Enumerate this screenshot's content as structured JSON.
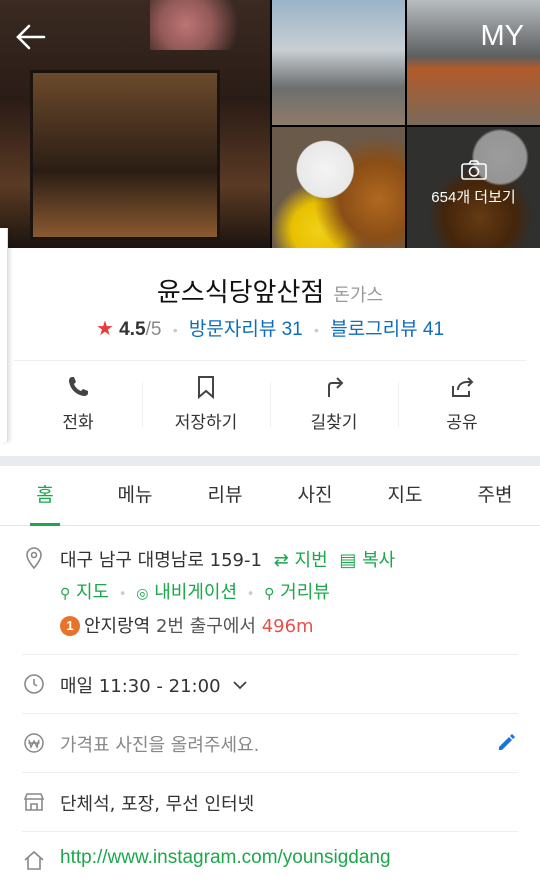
{
  "header": {
    "my_label": "MY",
    "more_photos_label": "654개 더보기"
  },
  "place": {
    "name": "윤스식당앞산점",
    "category": "돈가스",
    "rating": "4.5",
    "rating_max": "/5",
    "visitor_reviews_label": "방문자리뷰 31",
    "blog_reviews_label": "블로그리뷰 41"
  },
  "actions": [
    {
      "label": "전화",
      "icon": "phone-icon"
    },
    {
      "label": "저장하기",
      "icon": "bookmark-icon"
    },
    {
      "label": "길찾기",
      "icon": "directions-icon"
    },
    {
      "label": "공유",
      "icon": "share-icon"
    }
  ],
  "tabs": [
    "홈",
    "메뉴",
    "리뷰",
    "사진",
    "지도",
    "주변"
  ],
  "info": {
    "address": "대구 남구 대명남로 159-1",
    "lot_number_link": "지번",
    "copy_link": "복사",
    "map_link": "지도",
    "navigation_link": "내비게이션",
    "street_view_link": "거리뷰",
    "subway_line": "1",
    "subway_station": "안지랑역",
    "subway_exit": "2번 출구에서",
    "subway_distance": "496m",
    "hours": "매일 11:30 - 21:00",
    "price_prompt": "가격표 사진을 올려주세요.",
    "amenities": "단체석, 포장, 무선 인터넷",
    "website": "http://www.instagram.com/younsigdang"
  },
  "colors": {
    "accent_green": "#1ba84b",
    "link_blue": "#0d6ebd",
    "star_red": "#e83c3c",
    "subway_line1": "#e8742c"
  }
}
